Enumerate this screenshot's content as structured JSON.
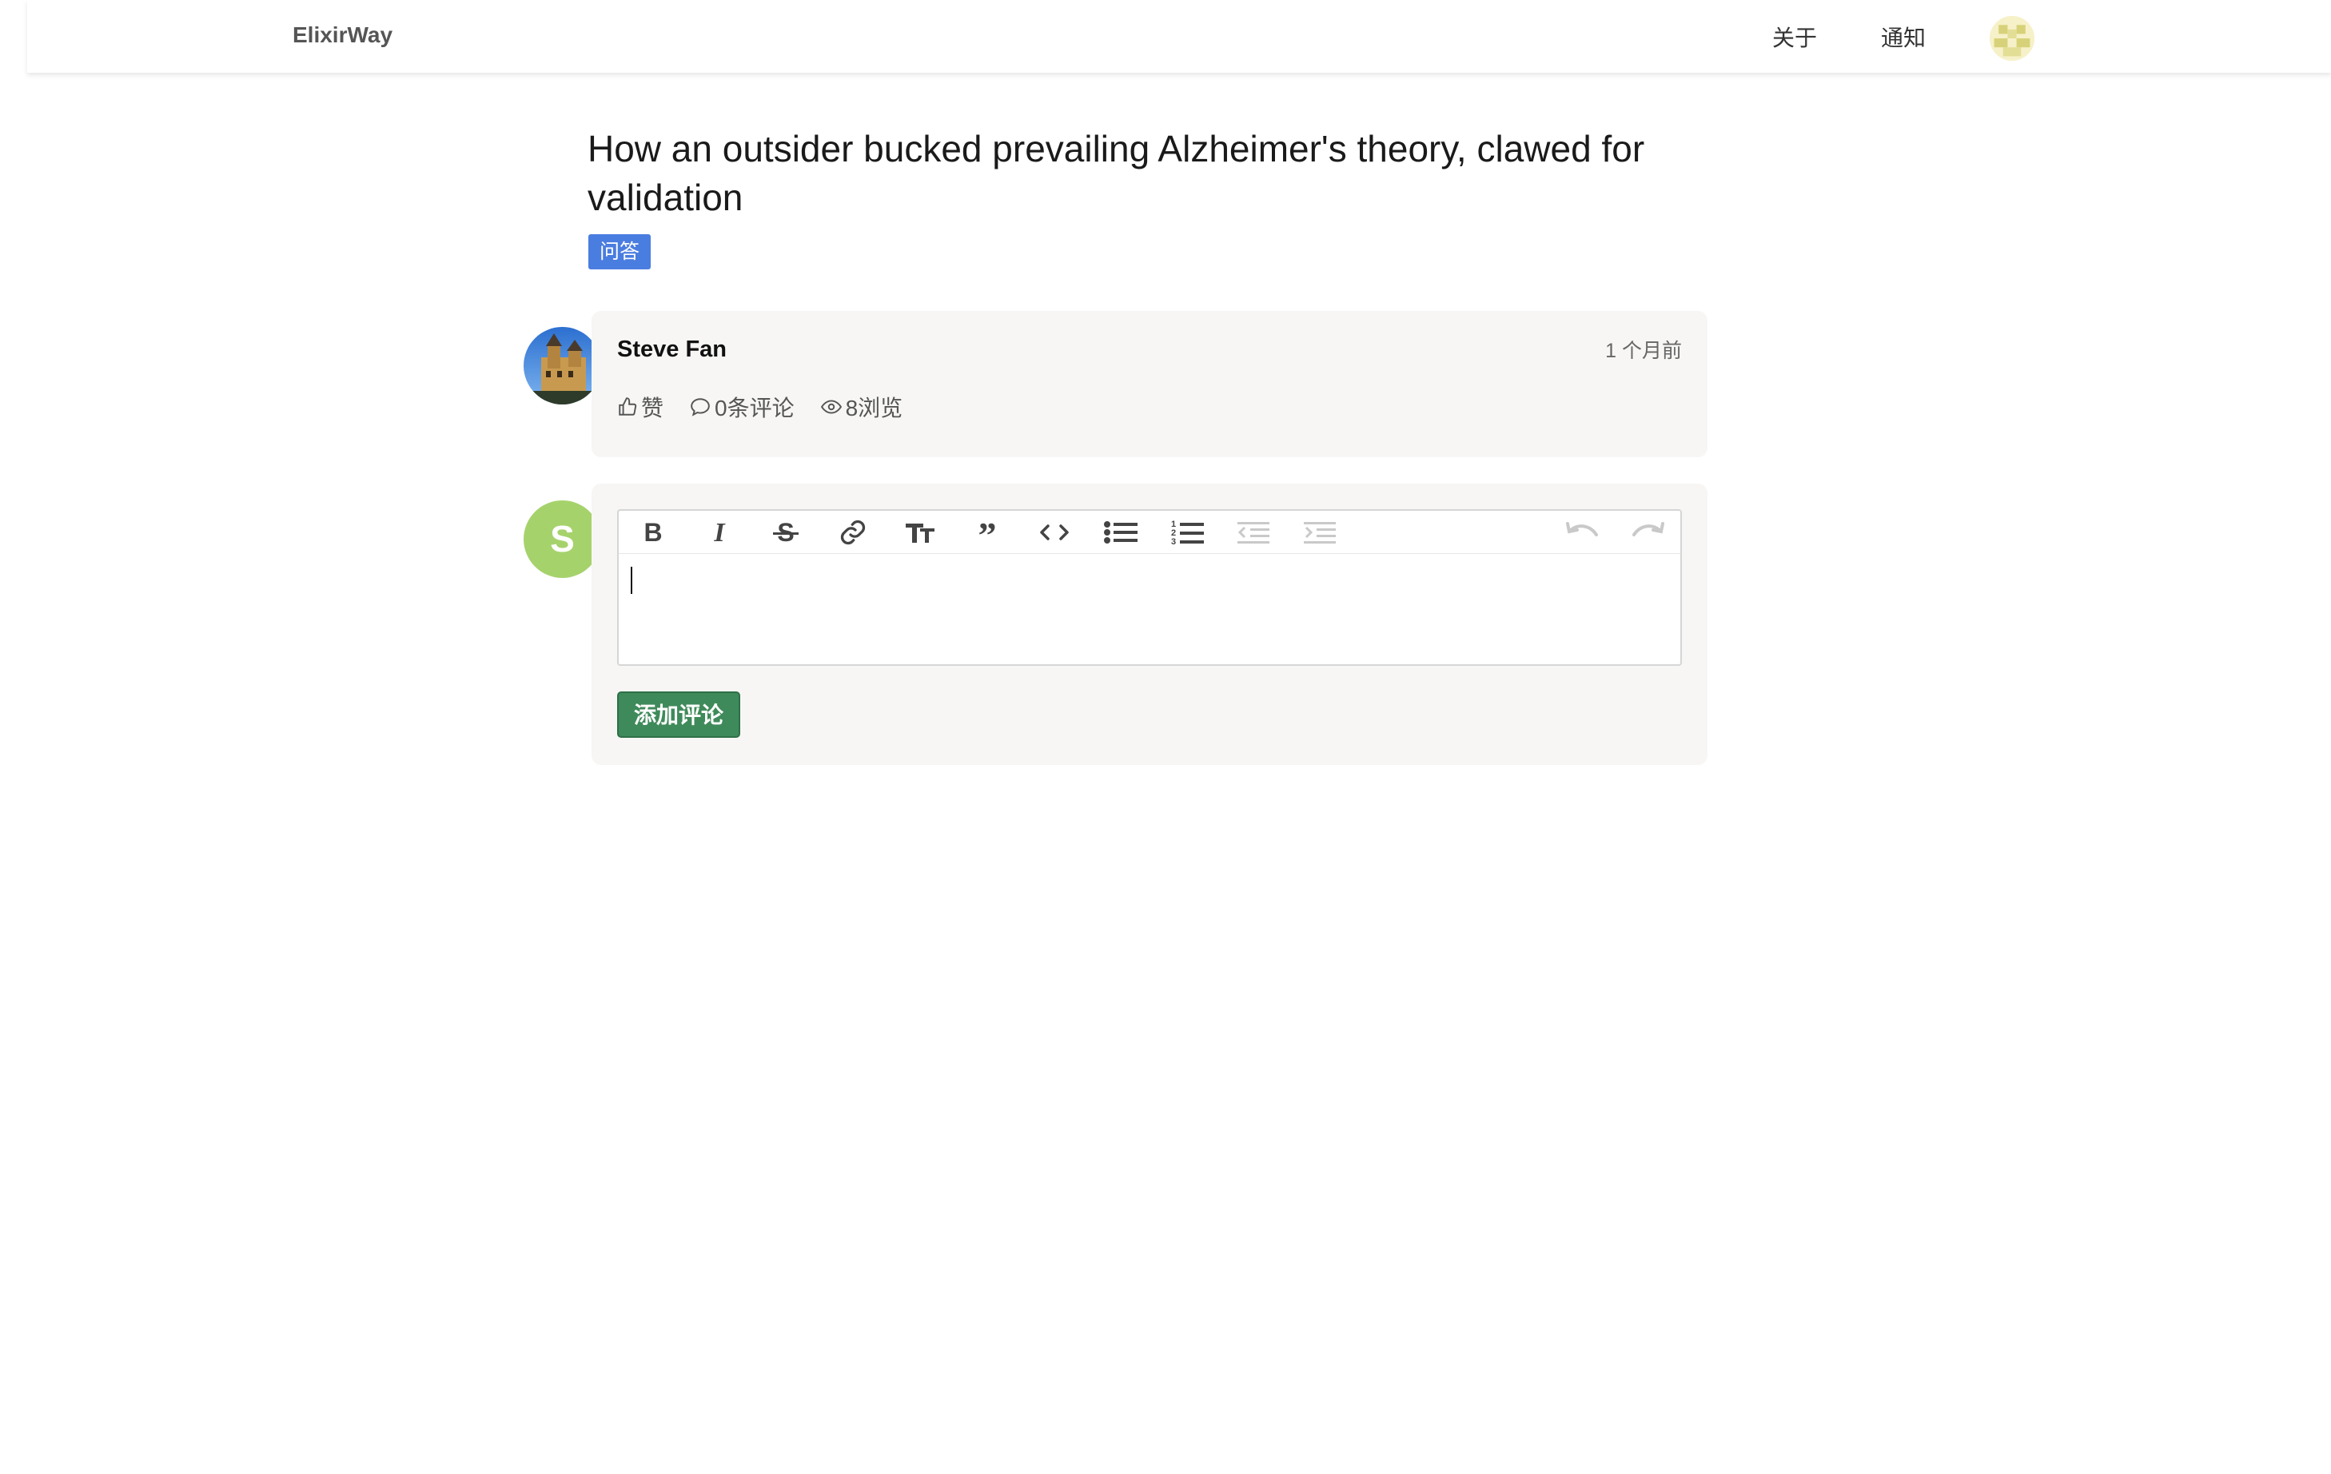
{
  "nav": {
    "brand": "ElixirWay",
    "links": [
      "关于",
      "通知"
    ],
    "avatar_icon": "user-avatar-icon"
  },
  "post": {
    "title": "How an outsider bucked prevailing Alzheimer's theory, clawed for validation",
    "tag": "问答",
    "author": "Steve Fan",
    "time": "1 个月前",
    "like_label": "赞",
    "comments_label": "0条评论",
    "views_label": "8浏览"
  },
  "comment": {
    "avatar_letter": "S",
    "submit_label": "添加评论",
    "toolbar": [
      "bold",
      "italic",
      "strikethrough",
      "link",
      "heading",
      "quote",
      "code",
      "bullet-list",
      "numbered-list",
      "outdent",
      "indent",
      "undo",
      "redo"
    ]
  },
  "colors": {
    "tag_bg": "#4a7de0",
    "submit_bg": "#3f8a5a",
    "avatar_s_bg": "#a6d26c",
    "card_bg": "#f7f6f4"
  }
}
